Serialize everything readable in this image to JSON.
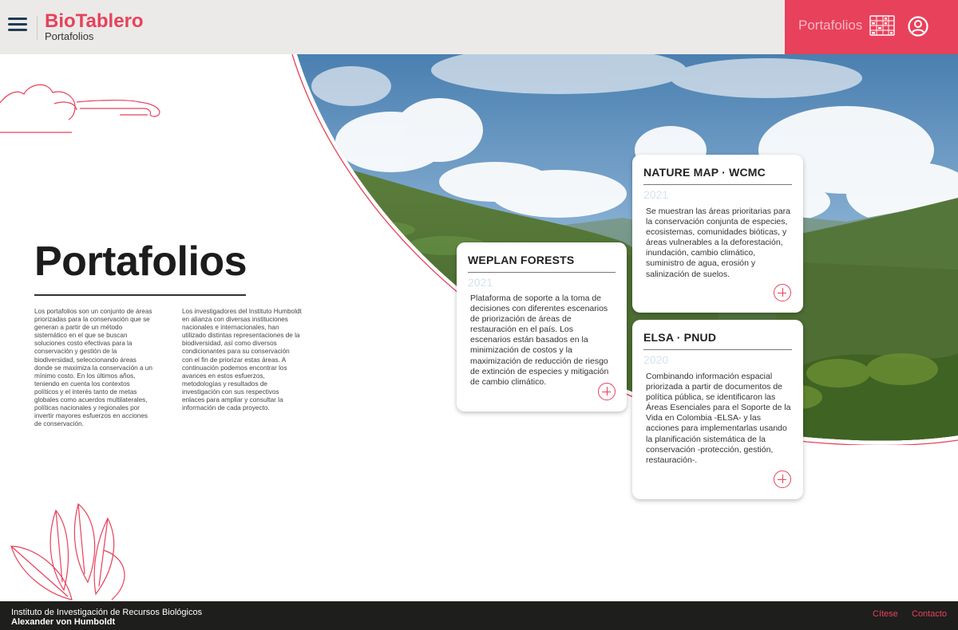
{
  "header": {
    "brand": "BioTablero",
    "subtitle": "Portafolios",
    "section_label": "Portafolios"
  },
  "main": {
    "title": "Portafolios",
    "intro_col1": "Los portafolios son un conjunto de áreas priorizadas para la conservación que se generan a partir de un método sistemático en el que se buscan soluciones costo efectivas para la conservación y gestión de la biodiversidad, seleccionando áreas donde se maximiza la conservación a un mínimo costo. En los últimos años, teniendo en cuenta los contextos políticos y el interés tanto de metas globales como acuerdos multilaterales, políticas nacionales y regionales por invertir mayores esfuerzos en acciones de conservación.",
    "intro_col2": "Los investigadores del Instituto Humboldt en alianza con diversas instituciones nacionales e internacionales, han utilizado distintas representaciones de la biodiversidad, así como diversos condicionantes para su conservación con el fin de priorizar estas áreas. A continuación podemos encontrar los avances en estos esfuerzos, metodologías y resultados de investigación con sus respectivos enlaces para ampliar y consultar la información de cada proyecto."
  },
  "cards": [
    {
      "title": "WEPLAN FORESTS",
      "year": "2021",
      "description": "Plataforma de soporte a la toma de decisiones con diferentes escenarios de priorización de áreas de restauración en el país. Los escenarios están basados en la minimización de costos y la maximización de reducción de riesgo de extinción de especies y mitigación de cambio climático."
    },
    {
      "title": "NATURE MAP · WCMC",
      "year": "2021",
      "description": "Se muestran las áreas prioritarias para la conservación conjunta de especies, ecosistemas, comunidades bióticas, y áreas vulnerables a la deforestación, inundación, cambio climático, suministro de agua, erosión y salinización de suelos."
    },
    {
      "title": "ELSA · PNUD",
      "year": "2020",
      "description": "Combinando información espacial priorizada a partir de documentos de política pública, se identificaron las Áreas Esenciales para el Soporte de la Vida en Colombia -ELSA- y las acciones para implementarlas usando la planificación sistemática de la conservación -protección, gestión, restauración-."
    }
  ],
  "footer": {
    "org_line1": "Instituto de Investigación de Recursos Biológicos",
    "org_line2": "Alexander von Humboldt",
    "link_cite": "Cítese",
    "link_contact": "Contacto"
  },
  "colors": {
    "accent": "#e8415b",
    "header_bg": "#ebeae8",
    "footer_bg": "#1e1e1c",
    "menu_icon": "#1f3c55"
  },
  "icons": [
    "menu-icon",
    "dashboard-grid-icon",
    "user-circle-icon",
    "plus-circle-icon",
    "cloud-decoration",
    "leaf-decoration"
  ]
}
